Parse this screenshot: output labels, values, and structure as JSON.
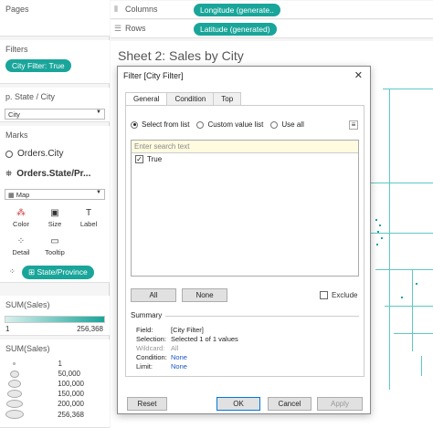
{
  "pages_title": "Pages",
  "filters": {
    "title": "Filters",
    "pill": "City Filter: True"
  },
  "quick_filter": {
    "title": "p. State / City",
    "value": "City"
  },
  "marks": {
    "title": "Marks",
    "rows": [
      "Orders.City",
      "Orders.State/Pr..."
    ],
    "type": "Map",
    "buttons": [
      "Color",
      "Size",
      "Label",
      "Detail",
      "Tooltip"
    ],
    "state_pill": "State/Province"
  },
  "sum_sales_color": {
    "title": "SUM(Sales)",
    "min": "1",
    "max": "256,368"
  },
  "sum_sales_size": {
    "title": "SUM(Sales)",
    "values": [
      "1",
      "50,000",
      "100,000",
      "150,000",
      "200,000",
      "256,368"
    ]
  },
  "shelves": {
    "columns_label": "Columns",
    "columns_pill": "Longitude (generate..",
    "rows_label": "Rows",
    "rows_pill": "Latitude (generated)"
  },
  "sheet": {
    "title": "Sheet 2: Sales by City"
  },
  "dialog": {
    "title": "Filter [City Filter]",
    "tabs": [
      "General",
      "Condition",
      "Top"
    ],
    "options": [
      "Select from list",
      "Custom value list",
      "Use all"
    ],
    "search_placeholder": "Enter search text",
    "items": [
      {
        "label": "True",
        "checked": "✓"
      }
    ],
    "all_button": "All",
    "none_button": "None",
    "exclude_label": "Exclude",
    "summary": {
      "title": "Summary",
      "field_k": "Field:",
      "field_v": "[City Filter]",
      "selection_k": "Selection:",
      "selection_v": "Selected 1 of 1 values",
      "wildcard_k": "Wildcard:",
      "wildcard_v": "All",
      "condition_k": "Condition:",
      "condition_v": "None",
      "limit_k": "Limit:",
      "limit_v": "None"
    },
    "reset_button": "Reset",
    "ok_button": "OK",
    "cancel_button": "Cancel",
    "apply_button": "Apply"
  }
}
